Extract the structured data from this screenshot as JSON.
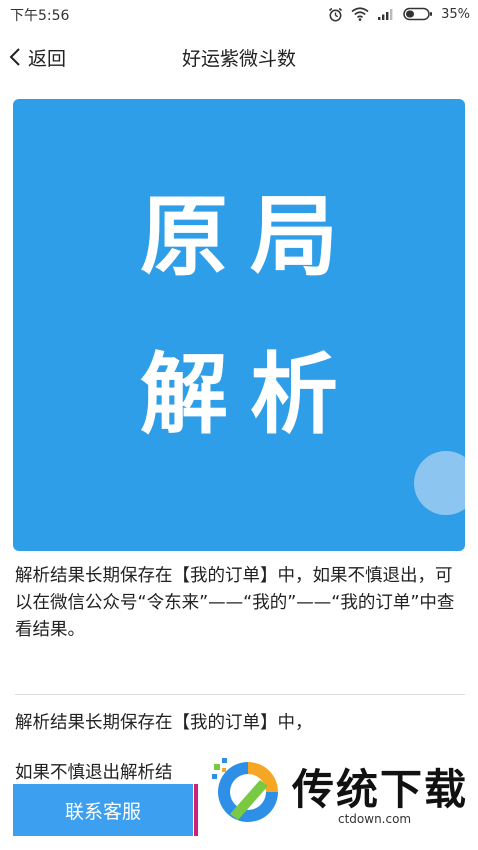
{
  "status_bar": {
    "time": "下午5:56",
    "battery": "35%",
    "icons": [
      "alarm-icon",
      "wifi-icon",
      "signal-icon",
      "battery-icon"
    ]
  },
  "nav": {
    "back_label": "返回",
    "title": "好运紫微斗数"
  },
  "banner": {
    "line1": "原局",
    "line2": "解析",
    "background_color": "#2f9ee8"
  },
  "notice_1": "解析结果长期保存在【我的订单】中，如果不慎退出，可以在微信公众号“令东来”——“我的”——“我的订单”中查看结果。",
  "notice_2": "解析结果长期保存在【我的订单】中，",
  "notice_3": "如果不慎退出解析结",
  "contact_button": {
    "label": "联系客服",
    "color": "#3d9fef"
  },
  "watermark": {
    "title": "传统下载",
    "url": "ctdown.com"
  }
}
